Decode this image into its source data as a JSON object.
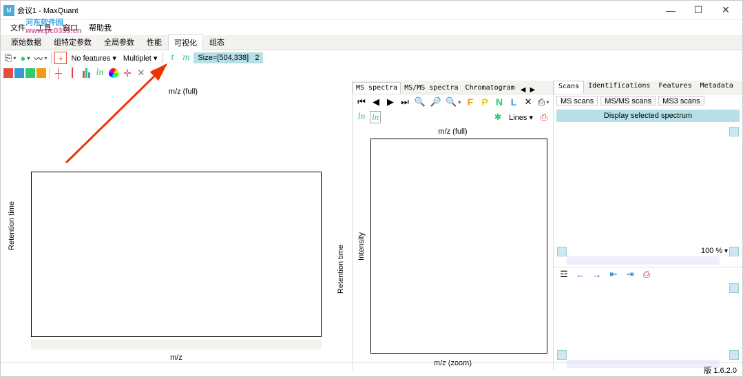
{
  "window": {
    "title": "会议1 - MaxQuant",
    "min": "—",
    "max": "☐",
    "close": "✕"
  },
  "watermark": {
    "name": "河东软件园",
    "url": "www.pc0359.cn"
  },
  "menu": [
    "文件",
    "工具",
    "窗口",
    "帮助我"
  ],
  "toptabs": {
    "items": [
      "原始数据",
      "组特定参数",
      "全局参数",
      "性能",
      "可视化",
      "组态"
    ],
    "active": 4
  },
  "toolbar1": {
    "plus": "+",
    "nofeat": "No features",
    "multiplet": "Multiplet",
    "t": "t",
    "m": "m",
    "size": "Size=[504,338]",
    "count": "2"
  },
  "toolbar2": {
    "ln": "ln"
  },
  "leftpane": {
    "ylabel": "Retention time",
    "top_xlabel": "m/z (full)",
    "bot_ylabel": "Retention time",
    "bot_xlabel": "m/z"
  },
  "midtabs": {
    "items": [
      "MS spectra",
      "MS/MS spectra",
      "Chromatogram"
    ],
    "active": 0
  },
  "midtb": {
    "F": "F",
    "P": "P",
    "N": "N",
    "L": "L",
    "lines": "Lines",
    "ln": "ln"
  },
  "midchart": {
    "top_xlabel": "m/z (full)",
    "ylabel": "Intensity",
    "bot_xlabel": "m/z (zoom)"
  },
  "righttabs": {
    "items": [
      "Scans",
      "Identifications",
      "Features",
      "Metadata"
    ],
    "active": 0
  },
  "subtabs": {
    "items": [
      "MS scans",
      "MS/MS scans",
      "MS3 scans"
    ],
    "active": 0
  },
  "rightpane": {
    "display_btn": "Display selected spectrum",
    "zoom": "100 %"
  },
  "status": {
    "version": "版 1.6.2.0"
  }
}
